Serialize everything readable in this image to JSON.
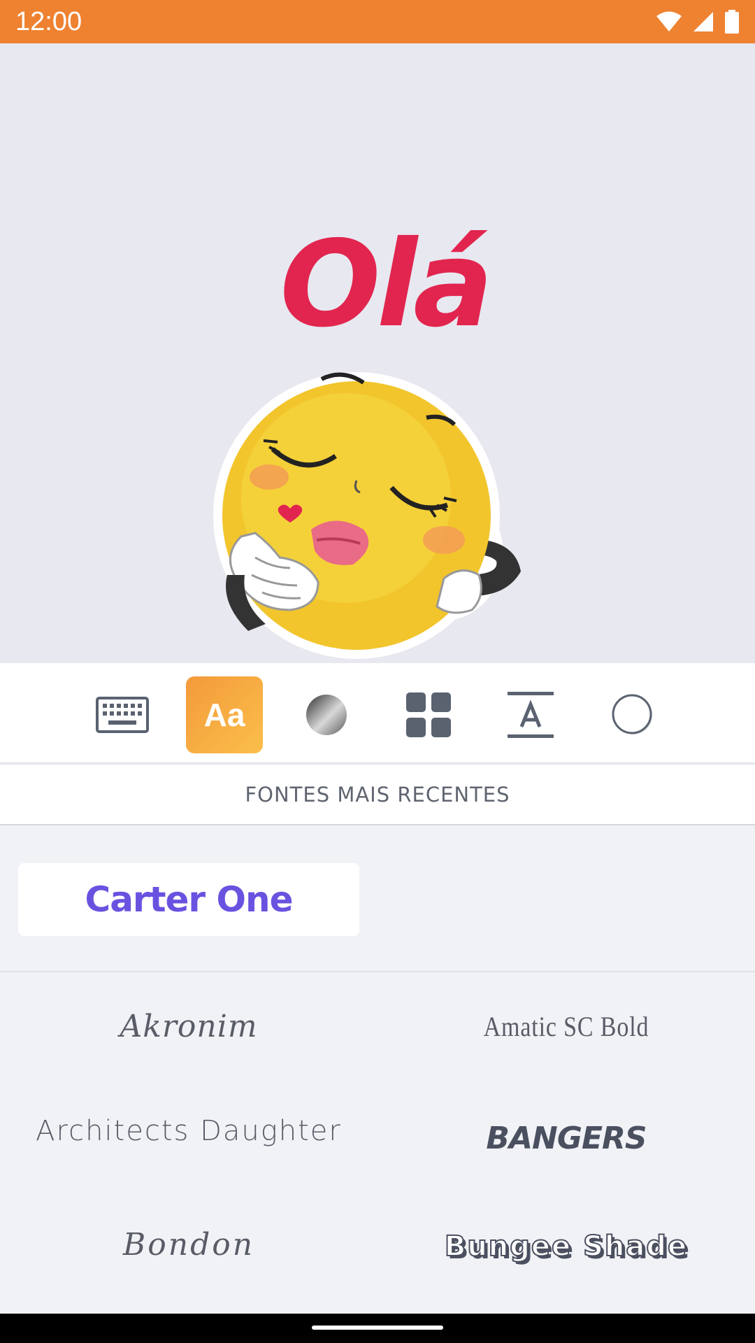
{
  "status_bar": {
    "time": "12:00",
    "icons": [
      "wifi-icon",
      "cell-signal-icon",
      "battery-icon"
    ]
  },
  "preview": {
    "sticker_text": "Olá",
    "sticker_color": "#e1254f",
    "emoji": "blowing-kiss-emoji"
  },
  "toolbar": {
    "tools": [
      {
        "name": "keyboard",
        "icon": "keyboard-icon",
        "active": false
      },
      {
        "name": "font",
        "label": "Aa",
        "active": true
      },
      {
        "name": "color",
        "icon": "gradient-circle-icon",
        "active": false
      },
      {
        "name": "layout",
        "icon": "grid-icon",
        "active": false
      },
      {
        "name": "text-style",
        "icon": "text-format-icon",
        "active": false
      },
      {
        "name": "outline",
        "icon": "circle-outline-icon",
        "active": false
      }
    ],
    "accent": "#f39a3b"
  },
  "section": {
    "recent_title": "FONTES MAIS RECENTES"
  },
  "recent_fonts": [
    {
      "label": "Carter One",
      "color": "#6a52e0"
    }
  ],
  "fonts": [
    {
      "label": "Akronim"
    },
    {
      "label": "Amatic SC Bold"
    },
    {
      "label": "Architects Daughter"
    },
    {
      "label": "Bangers"
    },
    {
      "label": "Bondon"
    },
    {
      "label": "Bungee Shade"
    }
  ]
}
